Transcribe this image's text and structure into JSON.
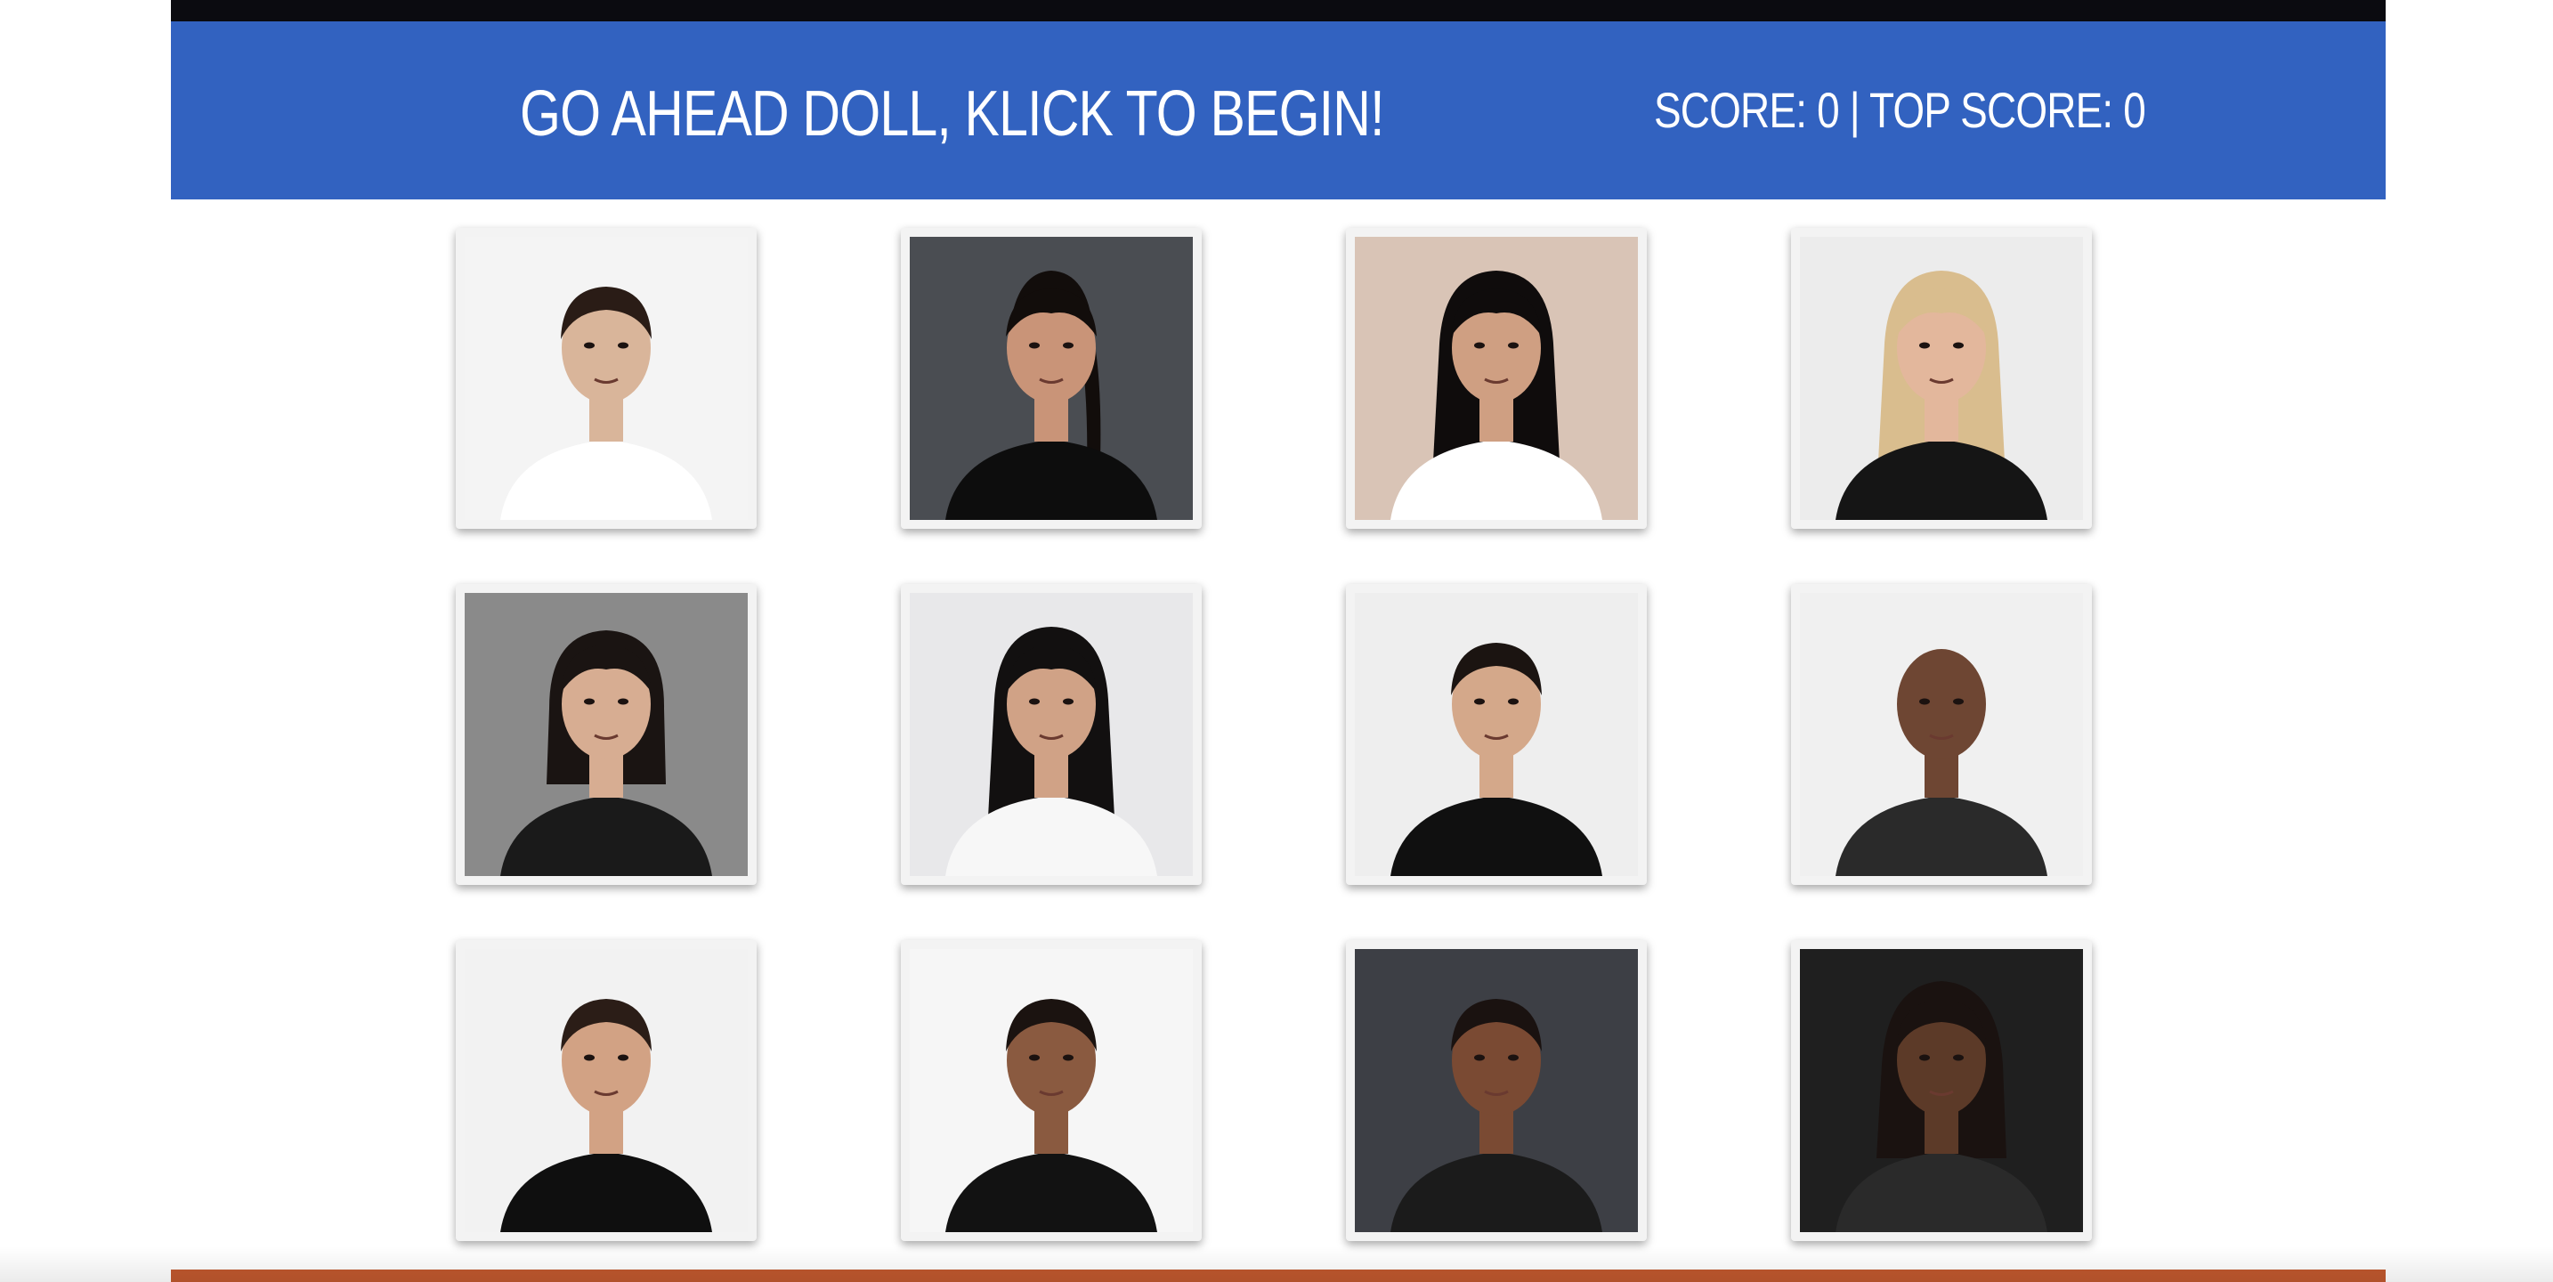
{
  "header": {
    "title": "GO AHEAD DOLL, KLICK TO BEGIN!",
    "score_label": "SCORE:",
    "score": "0",
    "separator": "|",
    "top_score_label": "TOP SCORE:",
    "top_score": "0"
  },
  "colors": {
    "header_bg": "#3262c0",
    "top_bar": "#0b0b10",
    "footer_bar": "#c0582e",
    "card_bg": "#f3f3f3"
  },
  "cards": [
    {
      "bg": "#f4f4f4",
      "skin": "#d9b59a",
      "hair": "#2a1c16",
      "hair_style": "short",
      "clothes": "#ffffff"
    },
    {
      "bg": "#4a4d52",
      "skin": "#c99478",
      "hair": "#120d0b",
      "hair_style": "ponytail",
      "clothes": "#0d0d0d"
    },
    {
      "bg": "#d9c4b6",
      "skin": "#cf9f82",
      "hair": "#0f0c0c",
      "hair_style": "long",
      "clothes": "#ffffff"
    },
    {
      "bg": "#ececec",
      "skin": "#e3b79c",
      "hair": "#d9bd8e",
      "hair_style": "long",
      "clothes": "#151515"
    },
    {
      "bg": "#8a8a8a",
      "skin": "#d7ad92",
      "hair": "#1a1412",
      "hair_style": "bob",
      "clothes": "#1a1a1a"
    },
    {
      "bg": "#e8e8ea",
      "skin": "#d0a286",
      "hair": "#121010",
      "hair_style": "long",
      "clothes": "#f7f7f7"
    },
    {
      "bg": "#eeeeee",
      "skin": "#d4a88a",
      "hair": "#1b1411",
      "hair_style": "short",
      "clothes": "#101010"
    },
    {
      "bg": "#f0f0f0",
      "skin": "#6e4633",
      "hair": "#6e4633",
      "hair_style": "bald",
      "clothes": "#2a2a2a"
    },
    {
      "bg": "#f2f2f2",
      "skin": "#d2a284",
      "hair": "#2b1d17",
      "hair_style": "short",
      "clothes": "#0f0f0f"
    },
    {
      "bg": "#f6f6f6",
      "skin": "#8a5a40",
      "hair": "#1b1310",
      "hair_style": "short",
      "clothes": "#121212"
    },
    {
      "bg": "#3d3f45",
      "skin": "#7a4a33",
      "hair": "#1a1210",
      "hair_style": "short",
      "clothes": "#1b1b1b"
    },
    {
      "bg": "#1f1f1f",
      "skin": "#5c3a28",
      "hair": "#1a1210",
      "hair_style": "dreads",
      "clothes": "#2a2a2a"
    }
  ]
}
